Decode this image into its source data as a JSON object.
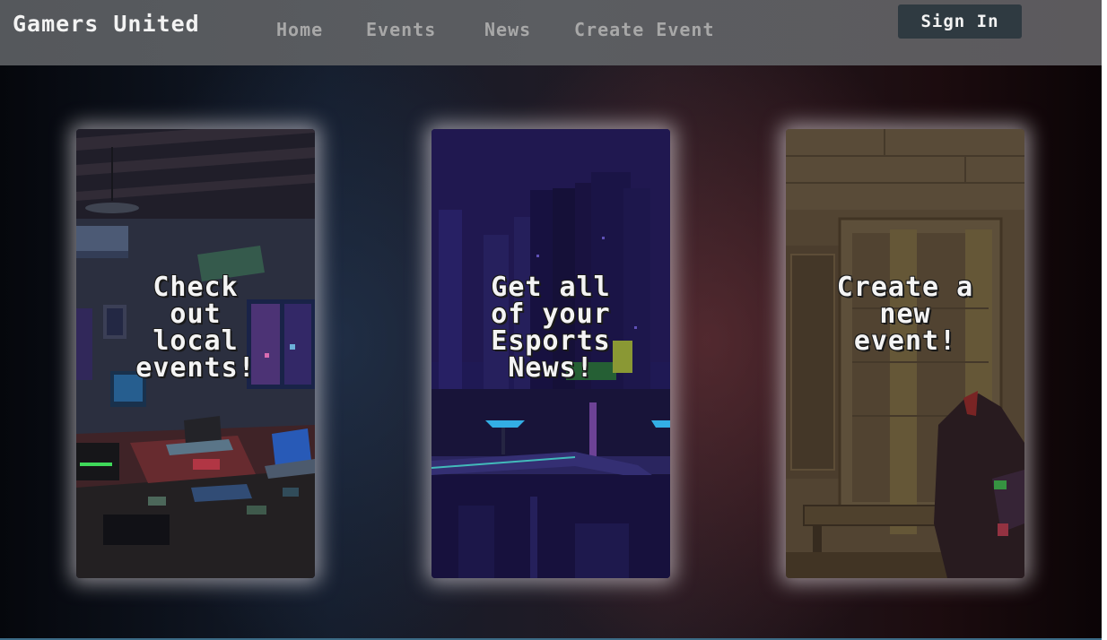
{
  "header": {
    "brand": "Gamers United",
    "nav": [
      {
        "label": "Home"
      },
      {
        "label": "Events"
      },
      {
        "label": "News"
      },
      {
        "label": "Create Event"
      }
    ],
    "sign_in_label": "Sign In"
  },
  "cards": [
    {
      "title": "Check\nout\nlocal\nevents!"
    },
    {
      "title": "Get all\nof your\nEsports\nNews!"
    },
    {
      "title": "Create a\nnew\nevent!"
    }
  ],
  "colors": {
    "navbar": "#5a5c60",
    "nav_link": "#a8a8a8",
    "sign_in_bg": "#2f3a41",
    "card_glow": "#ebe6eb"
  }
}
